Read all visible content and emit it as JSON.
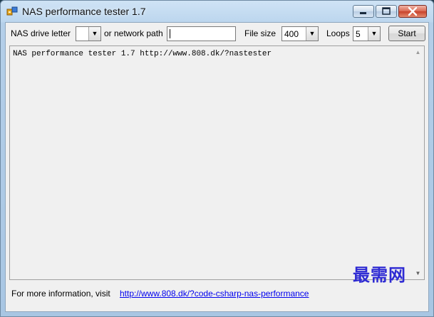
{
  "window": {
    "title": "NAS performance tester 1.7",
    "controls": [
      "minimize-icon",
      "maximize-icon",
      "close-icon"
    ]
  },
  "toolbar": {
    "drive_label": "NAS drive letter",
    "drive_value": "",
    "network_label": "or network path",
    "network_value": "",
    "filesize_label": "File size",
    "filesize_value": "400",
    "loops_label": "Loops",
    "loops_value": "5",
    "start_label": "Start"
  },
  "output": {
    "text": "NAS performance tester 1.7 http://www.808.dk/?nastester"
  },
  "footer": {
    "info_label": "For more information, visit",
    "link_text": "http://www.808.dk/?code-csharp-nas-performance"
  },
  "watermark": {
    "text": "最需网"
  },
  "colors": {
    "link": "#0000ee",
    "watermark": "#2f2bd3",
    "title_bar": "#bcd6ee"
  }
}
